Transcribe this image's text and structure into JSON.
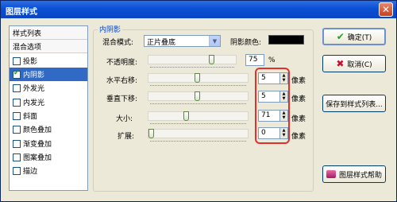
{
  "window": {
    "title": "图层样式",
    "close_label": "✕"
  },
  "sidebar": {
    "items": [
      {
        "label": "样式列表",
        "type": "header",
        "checked": false
      },
      {
        "label": "混合选项",
        "type": "header",
        "checked": false
      },
      {
        "label": "投影",
        "type": "check",
        "checked": false
      },
      {
        "label": "内阴影",
        "type": "check",
        "checked": true,
        "selected": true
      },
      {
        "label": "外发光",
        "type": "check",
        "checked": false
      },
      {
        "label": "内发光",
        "type": "check",
        "checked": false
      },
      {
        "label": "斜面",
        "type": "check",
        "checked": false
      },
      {
        "label": "颜色叠加",
        "type": "check",
        "checked": false
      },
      {
        "label": "渐变叠加",
        "type": "check",
        "checked": false
      },
      {
        "label": "图案叠加",
        "type": "check",
        "checked": false
      },
      {
        "label": "描边",
        "type": "check",
        "checked": false
      }
    ]
  },
  "panel": {
    "group_title": "内阴影",
    "blend_mode_label": "混合模式:",
    "blend_mode_value": "正片叠底",
    "shadow_color_label": "阴影颜色:",
    "shadow_color": "#000000",
    "opacity": {
      "label": "不透明度:",
      "value": "75",
      "unit": "%",
      "level": 0.75
    },
    "offset_x": {
      "label": "水平右移:",
      "value": "5",
      "unit": "像素",
      "level": 0.5
    },
    "offset_y": {
      "label": "垂直下移:",
      "value": "5",
      "unit": "像素",
      "level": 0.5
    },
    "size": {
      "label": "大小:",
      "value": "71",
      "unit": "像素",
      "level": 0.38
    },
    "spread": {
      "label": "扩展:",
      "value": "0",
      "unit": "像素",
      "level": 0.0
    }
  },
  "buttons": {
    "ok": "确定(T)",
    "cancel": "取消(C)",
    "save_to_list": "保存到样式列表...",
    "help": "图层样式帮助"
  },
  "colors": {
    "title_bar": "#0a4fd4",
    "selection": "#316ac5",
    "highlight_box": "#e0322b"
  }
}
